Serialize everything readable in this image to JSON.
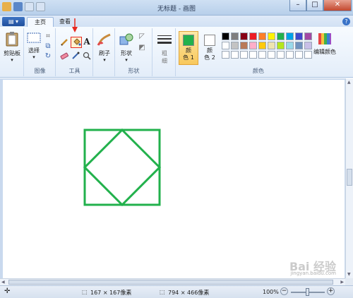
{
  "window": {
    "title": "无标题 - 画图",
    "minimize": "–",
    "maximize": "□",
    "close": "✕"
  },
  "tabs": {
    "app_menu": "▤ ▾",
    "home": "主页",
    "view": "查看",
    "help": "?"
  },
  "ribbon": {
    "clipboard": {
      "paste_label": "剪贴板",
      "group_label": ""
    },
    "image": {
      "select_label": "选择",
      "group_label": "图像"
    },
    "tools": {
      "group_label": "工具",
      "text_tool": "A"
    },
    "brushes": {
      "label": "刷子"
    },
    "shapes": {
      "label": "形状",
      "group_label": "形状"
    },
    "size": {
      "label_line1": "粗",
      "label_line2": "细"
    },
    "colors": {
      "color1_line1": "颜",
      "color1_line2": "色 1",
      "color2_line1": "颜",
      "color2_line2": "色 2",
      "edit_colors": "编辑颜色",
      "group_label": "颜色",
      "color1": "#22b14c",
      "color2": "#ffffff",
      "palette_row1": [
        "#000000",
        "#7f7f7f",
        "#880015",
        "#ed1c24",
        "#ff7f27",
        "#fff200",
        "#22b14c",
        "#00a2e8",
        "#3f48cc",
        "#a349a4"
      ],
      "palette_row2": [
        "#ffffff",
        "#c3c3c3",
        "#b97a57",
        "#ffaec9",
        "#ffc90e",
        "#efe4b0",
        "#b5e61d",
        "#99d9ea",
        "#7092be",
        "#c8bfe7"
      ],
      "palette_row3": [
        "#ffffff",
        "#ffffff",
        "#ffffff",
        "#ffffff",
        "#ffffff",
        "#ffffff",
        "#ffffff",
        "#ffffff",
        "#ffffff",
        "#ffffff"
      ]
    }
  },
  "canvas": {
    "drawing_color": "#22b14c",
    "shapes": [
      "square",
      "diamond"
    ]
  },
  "annotation": {
    "arrow_color": "#e8281f"
  },
  "status": {
    "move_icon": "✛",
    "selection_size": "167 × 167像素",
    "canvas_size": "794 × 466像素",
    "zoom": "100%",
    "zoom_out": "−",
    "zoom_in": "+"
  },
  "watermark": {
    "text": "Bai 经验",
    "sub": "jingyan.baidu.com"
  }
}
